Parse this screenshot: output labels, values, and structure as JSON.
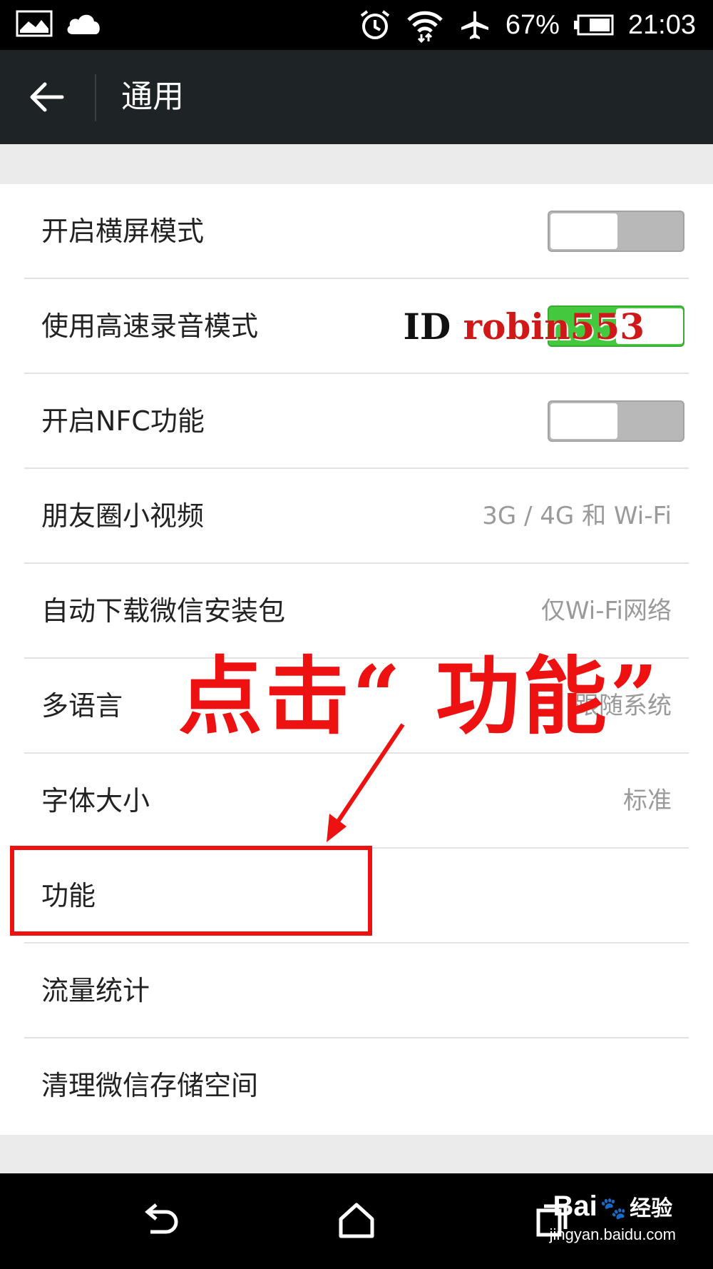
{
  "status_bar": {
    "battery_percent": "67%",
    "time": "21:03"
  },
  "title_bar": {
    "title": "通用"
  },
  "settings": [
    {
      "label": "开启横屏模式",
      "type": "switch",
      "on": false
    },
    {
      "label": "使用高速录音模式",
      "type": "switch",
      "on": true
    },
    {
      "label": "开启NFC功能",
      "type": "switch",
      "on": false
    },
    {
      "label": "朋友圈小视频",
      "type": "value",
      "value": "3G / 4G 和 Wi-Fi"
    },
    {
      "label": "自动下载微信安装包",
      "type": "value",
      "value": "仅Wi-Fi网络"
    },
    {
      "label": "多语言",
      "type": "value",
      "value": "跟随系统"
    },
    {
      "label": "字体大小",
      "type": "value",
      "value": "标准"
    },
    {
      "label": "功能",
      "type": "none"
    },
    {
      "label": "流量统计",
      "type": "none"
    },
    {
      "label": "清理微信存储空间",
      "type": "none"
    }
  ],
  "watermark": {
    "id": "ID",
    "name": "robin553"
  },
  "annotation": {
    "text": "点击“ 功能”",
    "color": "#ee1111"
  },
  "baidu_watermark": {
    "brand": "Bai",
    "brand_suffix": "经验",
    "site": "jingyan.baidu.com"
  },
  "colors": {
    "title_bar": "#1e2326",
    "switch_on": "#44c83d",
    "switch_off": "#b8b8b8"
  }
}
